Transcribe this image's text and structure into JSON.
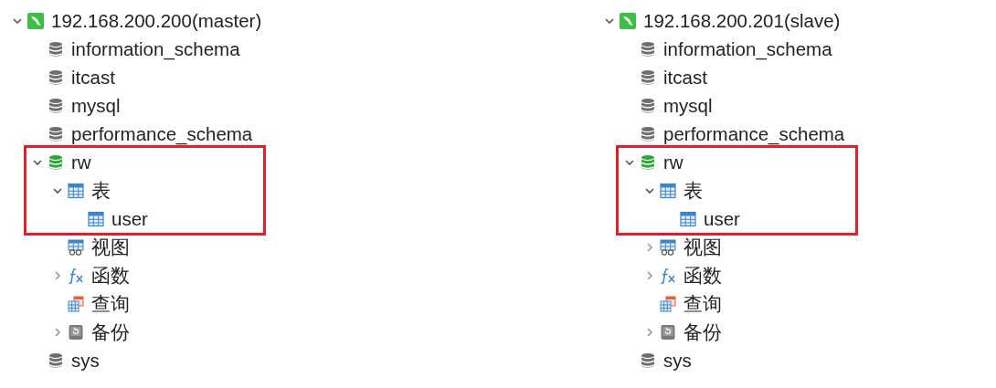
{
  "panels": [
    {
      "tree": [
        {
          "label": "192.168.200.200(master)",
          "kind": "connection",
          "expanded": true,
          "highlighted": false,
          "children": [
            {
              "label": "information_schema",
              "kind": "database",
              "open": false,
              "highlighted": false
            },
            {
              "label": "itcast",
              "kind": "database",
              "open": false,
              "highlighted": false
            },
            {
              "label": "mysql",
              "kind": "database",
              "open": false,
              "highlighted": false
            },
            {
              "label": "performance_schema",
              "kind": "database",
              "open": false,
              "highlighted": false
            },
            {
              "label": "rw",
              "kind": "database",
              "open": true,
              "expanded": true,
              "highlighted": true,
              "children": [
                {
                  "label": "表",
                  "kind": "tables",
                  "expanded": true,
                  "highlighted": true,
                  "children": [
                    {
                      "label": "user",
                      "kind": "table",
                      "highlighted": true
                    }
                  ]
                },
                {
                  "label": "视图",
                  "kind": "views",
                  "highlighted": false
                },
                {
                  "label": "函数",
                  "kind": "functions",
                  "expanded": false,
                  "highlighted": false
                },
                {
                  "label": "查询",
                  "kind": "queries",
                  "highlighted": false
                },
                {
                  "label": "备份",
                  "kind": "backups",
                  "expanded": false,
                  "highlighted": false
                }
              ]
            },
            {
              "label": "sys",
              "kind": "database",
              "open": false,
              "highlighted": false
            }
          ]
        }
      ]
    },
    {
      "tree": [
        {
          "label": "192.168.200.201(slave)",
          "kind": "connection",
          "expanded": true,
          "highlighted": false,
          "children": [
            {
              "label": "information_schema",
              "kind": "database",
              "open": false,
              "highlighted": false
            },
            {
              "label": "itcast",
              "kind": "database",
              "open": false,
              "highlighted": false
            },
            {
              "label": "mysql",
              "kind": "database",
              "open": false,
              "highlighted": false
            },
            {
              "label": "performance_schema",
              "kind": "database",
              "open": false,
              "highlighted": false
            },
            {
              "label": "rw",
              "kind": "database",
              "open": true,
              "expanded": true,
              "highlighted": true,
              "children": [
                {
                  "label": "表",
                  "kind": "tables",
                  "expanded": true,
                  "highlighted": true,
                  "children": [
                    {
                      "label": "user",
                      "kind": "table",
                      "highlighted": true
                    }
                  ]
                },
                {
                  "label": "视图",
                  "kind": "views",
                  "expanded": false,
                  "highlighted": false
                },
                {
                  "label": "函数",
                  "kind": "functions",
                  "expanded": false,
                  "highlighted": false
                },
                {
                  "label": "查询",
                  "kind": "queries",
                  "highlighted": false
                },
                {
                  "label": "备份",
                  "kind": "backups",
                  "expanded": false,
                  "highlighted": false
                }
              ]
            },
            {
              "label": "sys",
              "kind": "database",
              "open": false,
              "highlighted": false
            }
          ]
        }
      ]
    }
  ]
}
